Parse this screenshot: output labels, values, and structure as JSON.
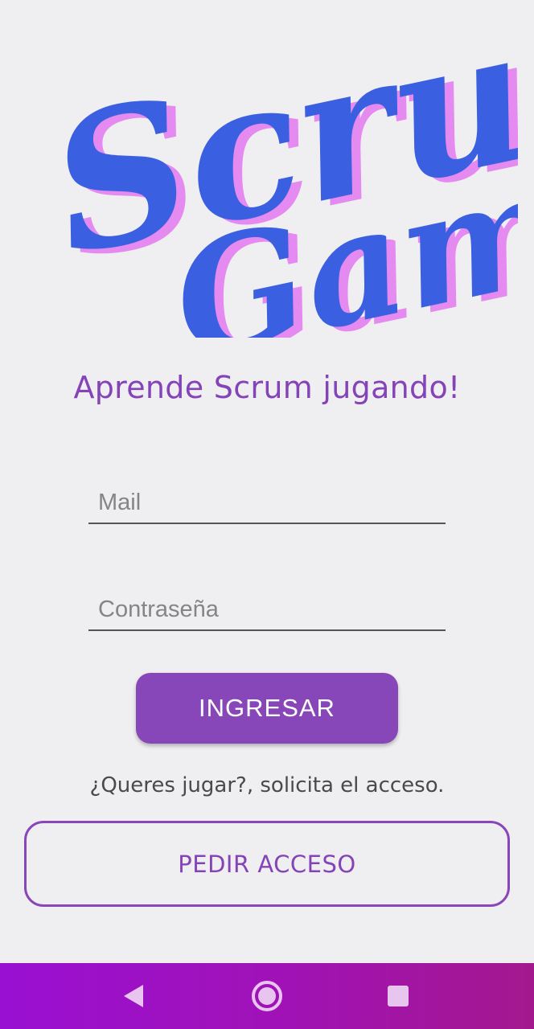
{
  "logo": {
    "line1": "Scrum",
    "line2": "Game",
    "colors": {
      "primary": "#3a5fe0",
      "shadow": "#e58af0"
    }
  },
  "tagline": "Aprende Scrum jugando!",
  "form": {
    "mail_placeholder": "Mail",
    "password_placeholder": "Contraseña",
    "login_label": "INGRESAR"
  },
  "hint": "¿Queres jugar?, solicita el acceso.",
  "request_label": "PEDIR ACCESO",
  "accent_color": "#8847b8",
  "navbar": {
    "icons": [
      "back-icon",
      "home-icon",
      "recents-icon"
    ]
  }
}
